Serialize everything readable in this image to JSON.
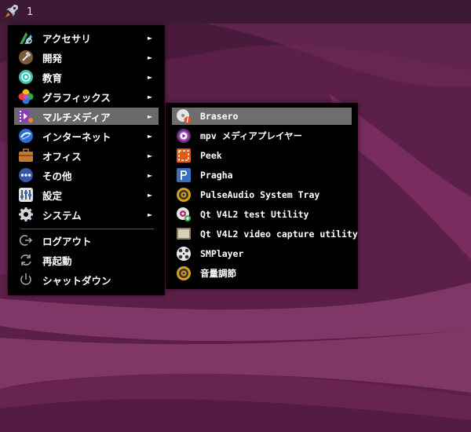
{
  "taskbar": {
    "desktop_number": "1",
    "launcher_icon": "rocket-icon"
  },
  "main_menu": {
    "items": [
      {
        "label": "アクセサリ",
        "icon": "accessories-icon",
        "has_submenu": true
      },
      {
        "label": "開発",
        "icon": "development-icon",
        "has_submenu": true
      },
      {
        "label": "教育",
        "icon": "education-icon",
        "has_submenu": true
      },
      {
        "label": "グラフィックス",
        "icon": "graphics-icon",
        "has_submenu": true
      },
      {
        "label": "マルチメディア",
        "icon": "multimedia-icon",
        "has_submenu": true,
        "selected": true
      },
      {
        "label": "インターネット",
        "icon": "internet-icon",
        "has_submenu": true
      },
      {
        "label": "オフィス",
        "icon": "office-icon",
        "has_submenu": true
      },
      {
        "label": "その他",
        "icon": "other-icon",
        "has_submenu": true
      },
      {
        "label": "設定",
        "icon": "settings-icon",
        "has_submenu": true
      },
      {
        "label": "システム",
        "icon": "system-icon",
        "has_submenu": true
      }
    ],
    "session": [
      {
        "label": "ログアウト",
        "icon": "logout-icon"
      },
      {
        "label": "再起動",
        "icon": "restart-icon"
      },
      {
        "label": "シャットダウン",
        "icon": "shutdown-icon"
      }
    ],
    "arrow": "►"
  },
  "submenu": {
    "items": [
      {
        "label": "Brasero",
        "icon": "brasero-icon",
        "selected": true
      },
      {
        "label": "mpv メディアプレイヤー",
        "icon": "mpv-icon"
      },
      {
        "label": "Peek",
        "icon": "peek-icon"
      },
      {
        "label": "Pragha",
        "icon": "pragha-icon"
      },
      {
        "label": "PulseAudio System Tray",
        "icon": "pulseaudio-icon"
      },
      {
        "label": "Qt V4L2 test Utility",
        "icon": "qv4l2-icon"
      },
      {
        "label": "Qt V4L2 video capture utility",
        "icon": "qvidcap-icon"
      },
      {
        "label": "SMPlayer",
        "icon": "smplayer-icon"
      },
      {
        "label": "音量調節",
        "icon": "volume-control-icon"
      }
    ]
  },
  "colors": {
    "menu_bg": "#000000",
    "selected_bg": "#6a6a6a",
    "taskbar_bg": "#3d1a33",
    "wallpaper": "#5a1f45"
  }
}
